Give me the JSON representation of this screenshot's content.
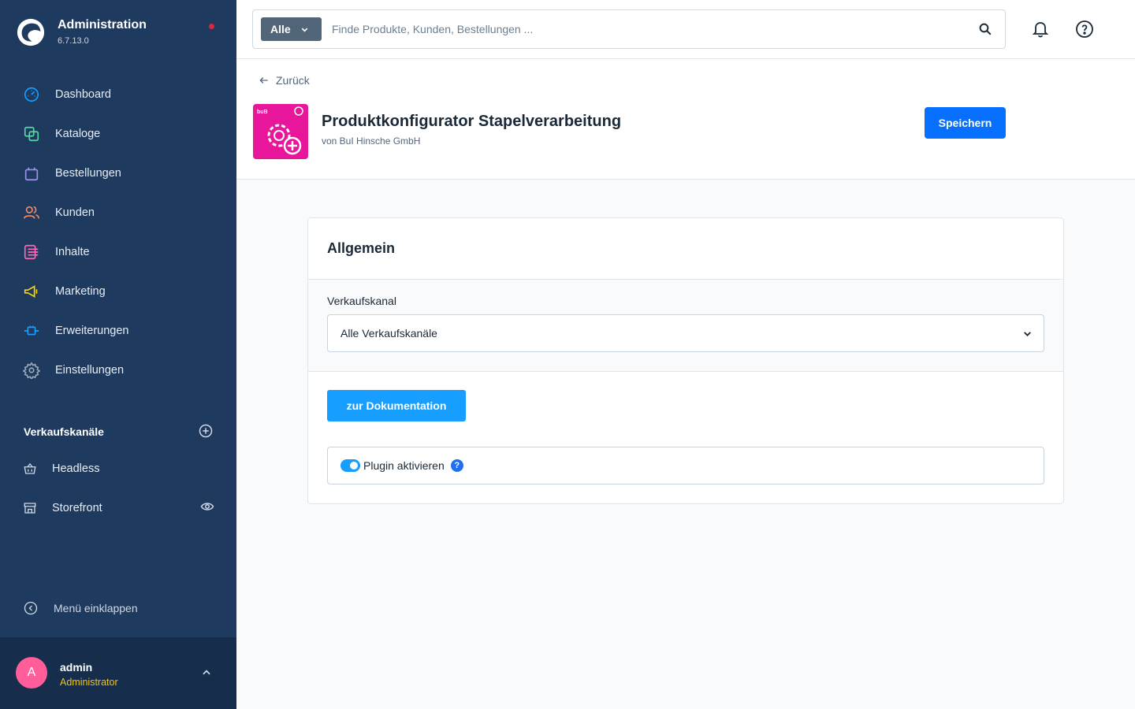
{
  "brand": {
    "title": "Administration",
    "version": "6.7.13.0",
    "notification_color": "#e0243a"
  },
  "nav": [
    {
      "label": "Dashboard",
      "icon": "dashboard-gauge-icon",
      "color": "#189eff"
    },
    {
      "label": "Kataloge",
      "icon": "catalog-squares-icon",
      "color": "#57d9a3"
    },
    {
      "label": "Bestellungen",
      "icon": "shopping-bag-icon",
      "color": "#a092f0"
    },
    {
      "label": "Kunden",
      "icon": "users-icon",
      "color": "#f88962"
    },
    {
      "label": "Inhalte",
      "icon": "content-list-icon",
      "color": "#ff68b4"
    },
    {
      "label": "Marketing",
      "icon": "megaphone-icon",
      "color": "#ffd700"
    },
    {
      "label": "Erweiterungen",
      "icon": "plug-icon",
      "color": "#189eff"
    },
    {
      "label": "Einstellungen",
      "icon": "gear-icon",
      "color": "#9aa8b5"
    }
  ],
  "sales_channels": {
    "heading": "Verkaufskanäle",
    "items": [
      {
        "label": "Headless",
        "icon": "basket-icon"
      },
      {
        "label": "Storefront",
        "icon": "storefront-icon"
      }
    ]
  },
  "collapse_label": "Menü einklappen",
  "user": {
    "initial": "A",
    "name": "admin",
    "role": "Administrator"
  },
  "search": {
    "type_label": "Alle",
    "placeholder": "Finde Produkte, Kunden, Bestellungen ..."
  },
  "page": {
    "back_label": "Zurück",
    "title": "Produktkonfigurator Stapelverarbeitung",
    "author": "von BuI Hinsche GmbH",
    "save_label": "Speichern"
  },
  "card": {
    "title": "Allgemein",
    "sales_channel_label": "Verkaufskanal",
    "sales_channel_value": "Alle Verkaufskanäle",
    "doc_button": "zur Dokumentation",
    "toggle_label": "Plugin aktivieren",
    "toggle_on": true,
    "help_glyph": "?"
  },
  "colors": {
    "sidebar": "#1f3a5f",
    "accent": "#189eff",
    "primary_button": "#0870ff",
    "plugin_icon": "#e7169b"
  }
}
